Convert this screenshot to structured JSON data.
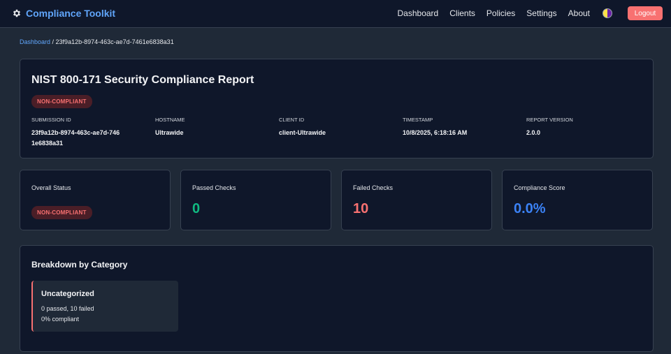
{
  "header": {
    "brand": "Compliance Toolkit",
    "nav": [
      "Dashboard",
      "Clients",
      "Policies",
      "Settings",
      "About"
    ],
    "logout_label": "Logout"
  },
  "breadcrumb": {
    "home": "Dashboard",
    "separator": " / ",
    "current": "23f9a12b-8974-463c-ae7d-7461e6838a31"
  },
  "report": {
    "title": "NIST 800-171 Security Compliance Report",
    "status_badge": "NON-COMPLIANT",
    "meta": [
      {
        "label": "Submission ID",
        "value": "23f9a12b-8974-463c-ae7d-7461e6838a31"
      },
      {
        "label": "Hostname",
        "value": "Ultrawide"
      },
      {
        "label": "Client ID",
        "value": "client-Ultrawide"
      },
      {
        "label": "Timestamp",
        "value": "10/8/2025, 6:18:16 AM"
      },
      {
        "label": "Report Version",
        "value": "2.0.0"
      }
    ]
  },
  "stats": {
    "overall_status": {
      "label": "Overall Status",
      "badge": "NON-COMPLIANT"
    },
    "passed": {
      "label": "Passed Checks",
      "value": "0"
    },
    "failed": {
      "label": "Failed Checks",
      "value": "10"
    },
    "score": {
      "label": "Compliance Score",
      "value": "0.0%"
    }
  },
  "breakdown": {
    "title": "Breakdown by Category",
    "categories": [
      {
        "name": "Uncategorized",
        "summary": "0 passed, 10 failed",
        "compliance": "0% compliant"
      }
    ]
  },
  "colors": {
    "accent": "#60a5fa",
    "passed": "#10b981",
    "failed": "#f87171",
    "score": "#3b82f6",
    "badge_bg": "#4a1e27"
  },
  "icons": {
    "brand": "gear-icon",
    "theme_toggle": "theme-toggle-icon"
  }
}
